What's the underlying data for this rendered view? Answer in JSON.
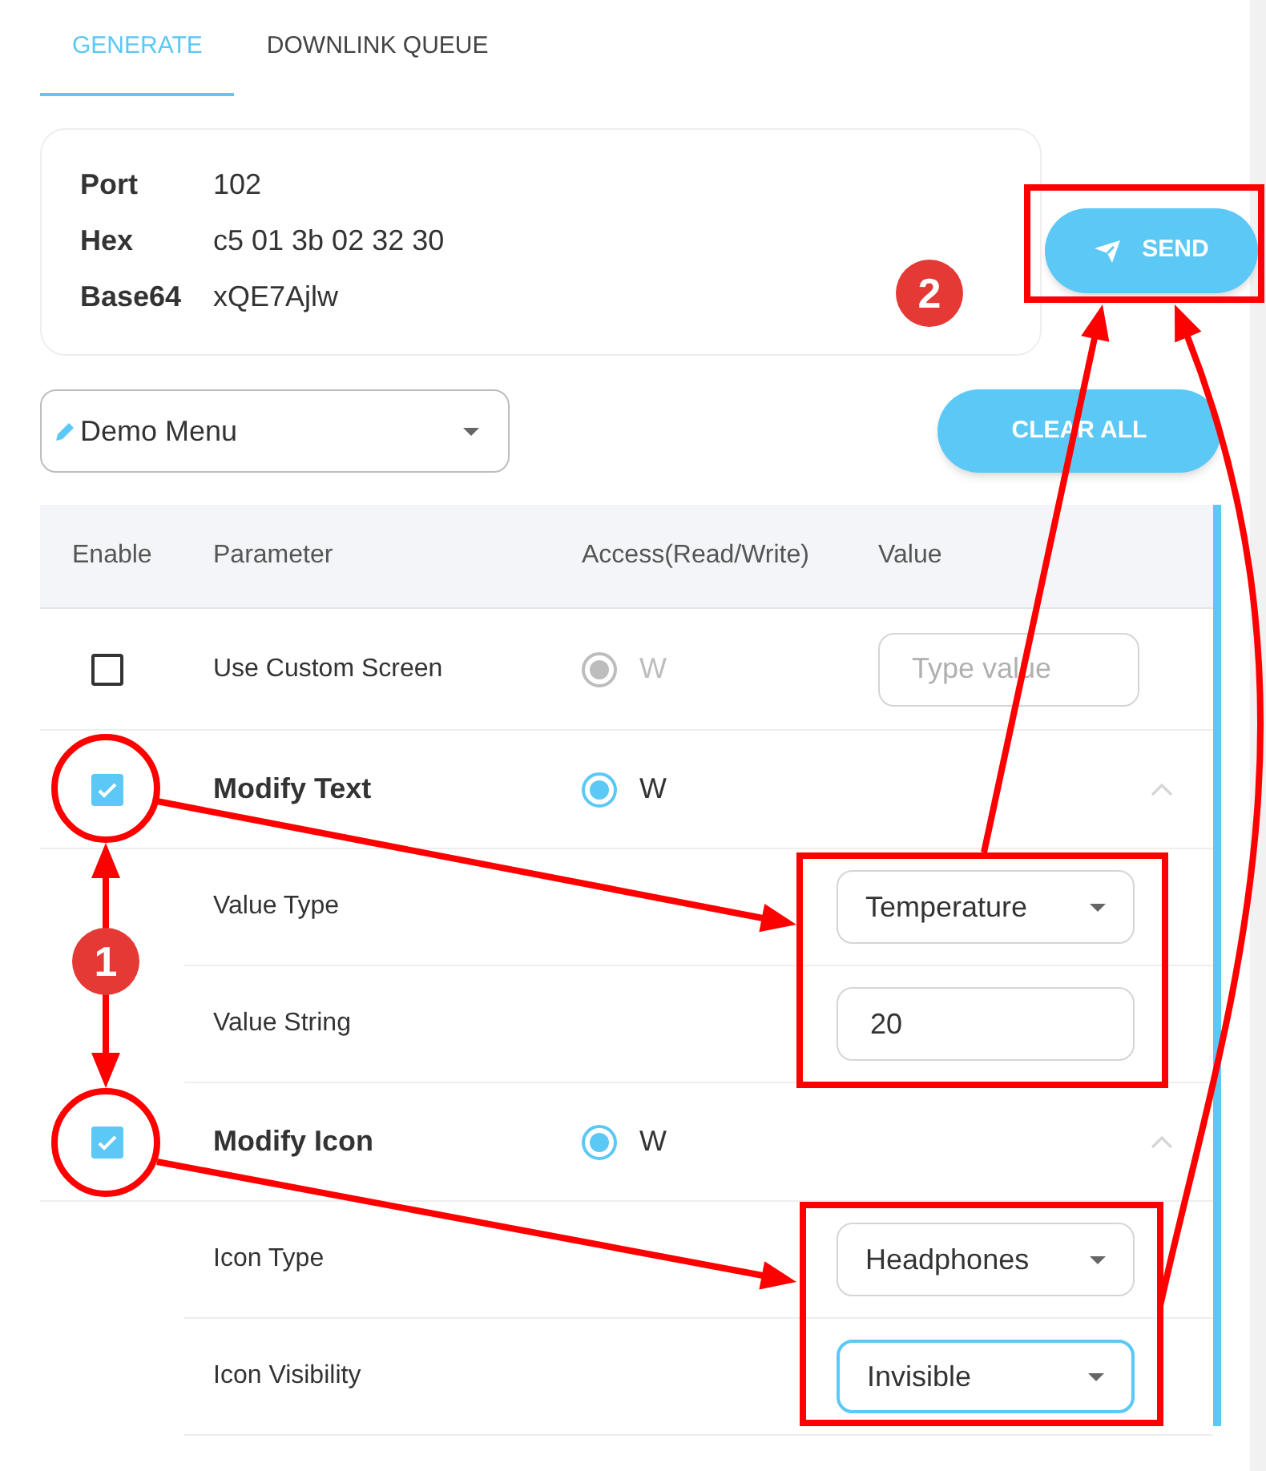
{
  "tabs": [
    {
      "label": "GENERATE",
      "selected": true
    },
    {
      "label": "DOWNLINK QUEUE",
      "selected": false
    }
  ],
  "payload": {
    "fields": [
      {
        "label": "Port",
        "value": "102"
      },
      {
        "label": "Hex",
        "value": "c5 01 3b 02 32 30"
      },
      {
        "label": "Base64",
        "value": "xQE7Ajlw"
      }
    ]
  },
  "send_button": {
    "label": "SEND"
  },
  "menu_select": {
    "value": "Demo Menu"
  },
  "clear_button": {
    "label": "CLEAR ALL"
  },
  "table": {
    "columns": [
      "Enable",
      "Parameter",
      "Access(Read/Write)",
      "Value"
    ],
    "rows": [
      {
        "name": "Use Custom Screen",
        "checked": false,
        "access": {
          "label": "W",
          "selected": true,
          "disabled": true
        },
        "control": {
          "kind": "input",
          "placeholder": "Type value"
        }
      },
      {
        "name": "Modify Text",
        "checked": true,
        "access": {
          "label": "W",
          "selected": true,
          "disabled": false
        },
        "expanded": true,
        "children": [
          {
            "name": "Value Type",
            "control": {
              "kind": "select",
              "value": "Temperature",
              "focused": false
            }
          },
          {
            "name": "Value String",
            "control": {
              "kind": "input",
              "value": "20"
            }
          }
        ]
      },
      {
        "name": "Modify Icon",
        "checked": true,
        "access": {
          "label": "W",
          "selected": true,
          "disabled": false
        },
        "expanded": true,
        "children": [
          {
            "name": "Icon Type",
            "control": {
              "kind": "select",
              "value": "Headphones",
              "focused": false
            }
          },
          {
            "name": "Icon Visibility",
            "control": {
              "kind": "select",
              "value": "Invisible",
              "focused": true
            }
          }
        ]
      }
    ]
  },
  "annotations": {
    "badges": [
      {
        "label": "1"
      },
      {
        "label": "2"
      }
    ]
  }
}
